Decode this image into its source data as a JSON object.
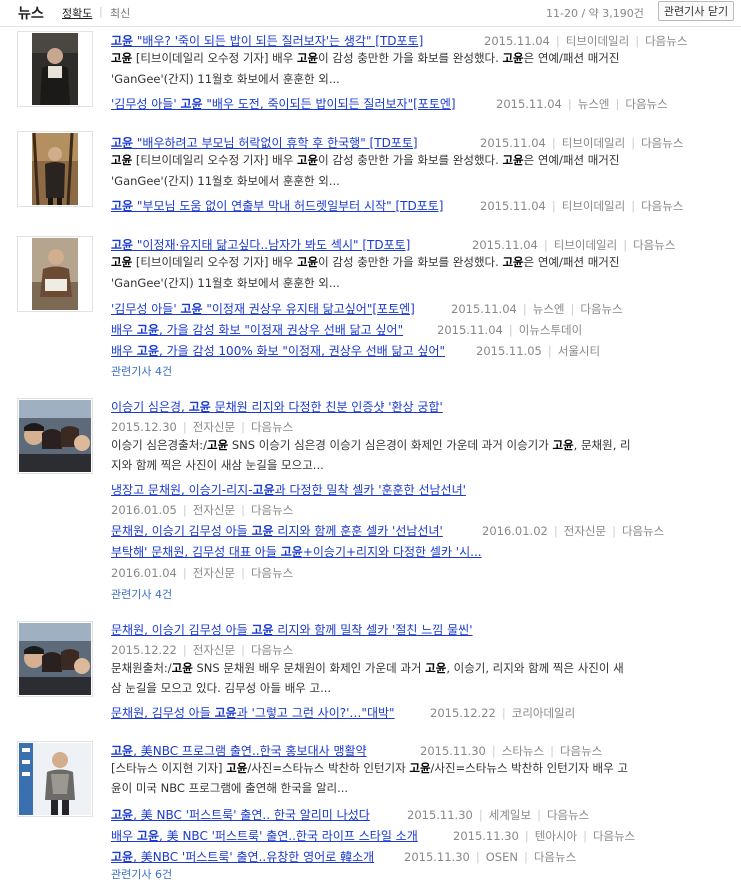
{
  "header": {
    "title": "뉴스",
    "sort_accuracy": "정확도",
    "sort_divider": "|",
    "sort_latest": "최신",
    "result_count": "11-20 / 약 3,190건",
    "close_related": "관련기사 닫기"
  },
  "items": [
    {
      "title": "고윤 \"배우? '죽이 되든 밥이 되든 질러보자'는 생각\" [TD포토]",
      "date": "2015.11.04",
      "source": "티브이데일리",
      "portal": "다음뉴스",
      "desc1": "고윤 [티브이데일리 오수정 기자] 배우 고윤이 감성 충만한 가을 화보를 완성했다. 고윤은 연예/패션 매거진",
      "desc2": "'GanGee'(간지) 11월호 화보에서 훈훈한 외...",
      "related": [
        {
          "title": "'김무성 아들' 고윤 \"배우 도전, 죽이되든 밥이되든 질러보자\"[포토엔]",
          "date": "2015.11.04",
          "source": "뉴스엔",
          "portal": "다음뉴스"
        }
      ]
    },
    {
      "title": "고윤 \"배우하려고 부모님 허락없이 휴학 후 한국행\" [TD포토]",
      "date": "2015.11.04",
      "source": "티브이데일리",
      "portal": "다음뉴스",
      "desc1": "고윤 [티브이데일리 오수정 기자] 배우 고윤이 감성 충만한 가을 화보를 완성했다. 고윤은 연예/패션 매거진",
      "desc2": "'GanGee'(간지) 11월호 화보에서 훈훈한 외...",
      "related": [
        {
          "title": "고윤 \"부모님 도움 없이 연출부 막내 허드렛일부터 시작\" [TD포토]",
          "date": "2015.11.04",
          "source": "티브이데일리",
          "portal": "다음뉴스"
        }
      ]
    },
    {
      "title": "고윤 \"이정재·유지태 닮고싶다..남자가 봐도 섹시\" [TD포토]",
      "date": "2015.11.04",
      "source": "티브이데일리",
      "portal": "다음뉴스",
      "desc1": "고윤 [티브이데일리 오수정 기자] 배우 고윤이 감성 충만한 가을 화보를 완성했다. 고윤은 연예/패션 매거진",
      "desc2": "'GanGee'(간지) 11월호 화보에서 훈훈한 외...",
      "related": [
        {
          "title": "'김무성 아들' 고윤 \"이정재 권상우 유지태 닮고싶어\"[포토엔]",
          "date": "2015.11.04",
          "source": "뉴스엔",
          "portal": "다음뉴스"
        },
        {
          "title": "배우 고윤, 가을 감성 화보 \"이정재 권상우 선배 닮고 싶어\"",
          "date": "2015.11.04",
          "source": "이뉴스투데이",
          "portal": ""
        },
        {
          "title": "배우 고윤, 가을 감성 100% 화보 \"이정재, 권상우 선배 닮고 싶어\"",
          "date": "2015.11.05",
          "source": "서울시티",
          "portal": ""
        }
      ],
      "related_count": "관련기사 4건"
    },
    {
      "title": "이승기 심은경, 고윤 문채원 리지와 다정한 친분 인증샷 '환상 궁합'",
      "date": "2015.12.30",
      "source": "전자신문",
      "portal": "다음뉴스",
      "desc1": "이승기 심은경출처:/고윤 SNS 이승기 심은경 이승기 심은경이 화제인 가운데 과거 이승기가 고윤, 문채원, 리",
      "desc2": "지와 함께 찍은 사진이 새삼 눈길을 모으고...",
      "related": [
        {
          "title": "냉장고 문채원, 이승기-리지-고윤과 다정한 밀착 셀카 '훈훈한 선남선녀'",
          "date": "2016.01.05",
          "source": "전자신문",
          "portal": "다음뉴스"
        },
        {
          "title": "문채원, 이승기 김무성 아들 고윤 리지와 함께 훈훈 셀카 '선남선녀'",
          "date": "2016.01.02",
          "source": "전자신문",
          "portal": "다음뉴스"
        },
        {
          "title": "부탁해' 문채원, 김무성 대표 아들 고윤+이승기+리지와 다정한 셀카 '시...",
          "date": "2016.01.04",
          "source": "전자신문",
          "portal": "다음뉴스"
        }
      ],
      "related_count": "관련기사 4건"
    },
    {
      "title": "문채원, 이승기 김무성 아들 고윤 리지와 함께 밀착 셀카 '절친 느낌 물씬'",
      "date": "2015.12.22",
      "source": "전자신문",
      "portal": "다음뉴스",
      "desc1": "문채원출처:/고윤 SNS 문채원 배우 문채원이 화제인 가운데 과거 고윤, 이승기, 리지와 함께 찍은 사진이 새",
      "desc2": "삼 눈길을 모으고 있다. 김무성 아들 배우 고...",
      "related": [
        {
          "title": "문채원, 김무성 아들 고윤과 '그렇고 그런 사이?'…\"대박\"",
          "date": "2015.12.22",
          "source": "코리아데일리",
          "portal": ""
        }
      ]
    },
    {
      "title": "고윤, 美NBC 프로그램 출연..한국 홍보대사 맹활약",
      "date": "2015.11.30",
      "source": "스타뉴스",
      "portal": "다음뉴스",
      "desc1": "[스타뉴스 이지현 기자] 고윤/사진=스타뉴스 박찬하 인턴기자 고윤/사진=스타뉴스 박찬하 인턴기자 배우 고",
      "desc2": "윤이 미국 NBC 프로그램에 출연해 한국을 알리...",
      "related": [
        {
          "title": "고윤, 美 NBC '퍼스트룩' 출연.. 한국 알리미 나섰다",
          "date": "2015.11.30",
          "source": "세계일보",
          "portal": "다음뉴스"
        },
        {
          "title": "배우 고윤, 美 NBC '퍼스트룩' 출연..한국 라이프 스타일 소개",
          "date": "2015.11.30",
          "source": "텐아시아",
          "portal": "다음뉴스"
        },
        {
          "title": "고윤, 美NBC '퍼스트룩' 출연..유창한 영어로 韓소개",
          "date": "2015.11.30",
          "source": "OSEN",
          "portal": "다음뉴스"
        }
      ],
      "related_count": "관련기사 6건"
    }
  ]
}
